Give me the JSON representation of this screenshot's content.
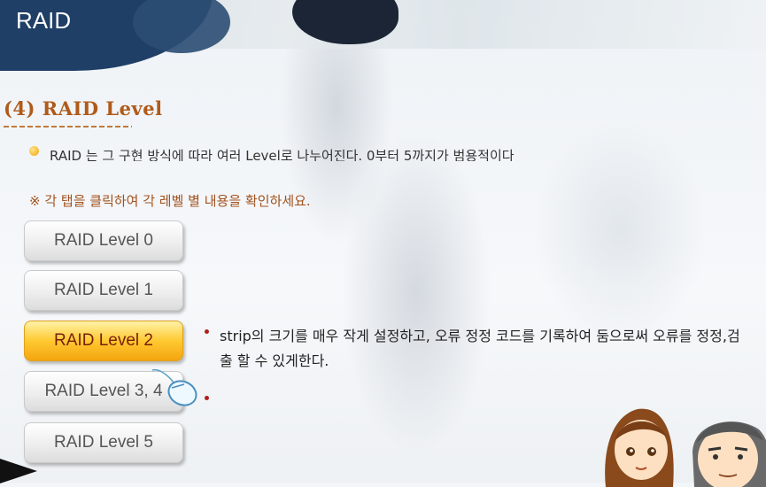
{
  "header": {
    "title": "RAID"
  },
  "section": {
    "title": "(4) RAID Level",
    "intro": "RAID 는 그 구현 방식에 따라 여러 Level로 나누어진다. 0부터 5까지가 범용적이다",
    "instruction": "※ 각 탭을 클릭하여 각 레벨 별 내용을 확인하세요."
  },
  "tabs": [
    {
      "label": "RAID Level 0",
      "active": false
    },
    {
      "label": "RAID Level 1",
      "active": false
    },
    {
      "label": "RAID Level 2",
      "active": true
    },
    {
      "label": "RAID Level 3, 4",
      "active": false
    },
    {
      "label": "RAID Level 5",
      "active": false
    }
  ],
  "content": {
    "bullets": [
      "strip의 크기를 매우 작게 설정하고, 오류 정정 코드를 기록하여 둠으로써 오류를 정정,검출 할 수 있게한다.",
      ""
    ]
  },
  "colors": {
    "header_band": "#1f3f66",
    "section_title": "#b05a1a",
    "instruction": "#a0521d",
    "active_tab": "#ffc931",
    "bullet_red": "#b0201a"
  },
  "icons": [
    "hand-mouse-cursor-icon",
    "bullet-dot-icon",
    "next-arrow-icon"
  ]
}
